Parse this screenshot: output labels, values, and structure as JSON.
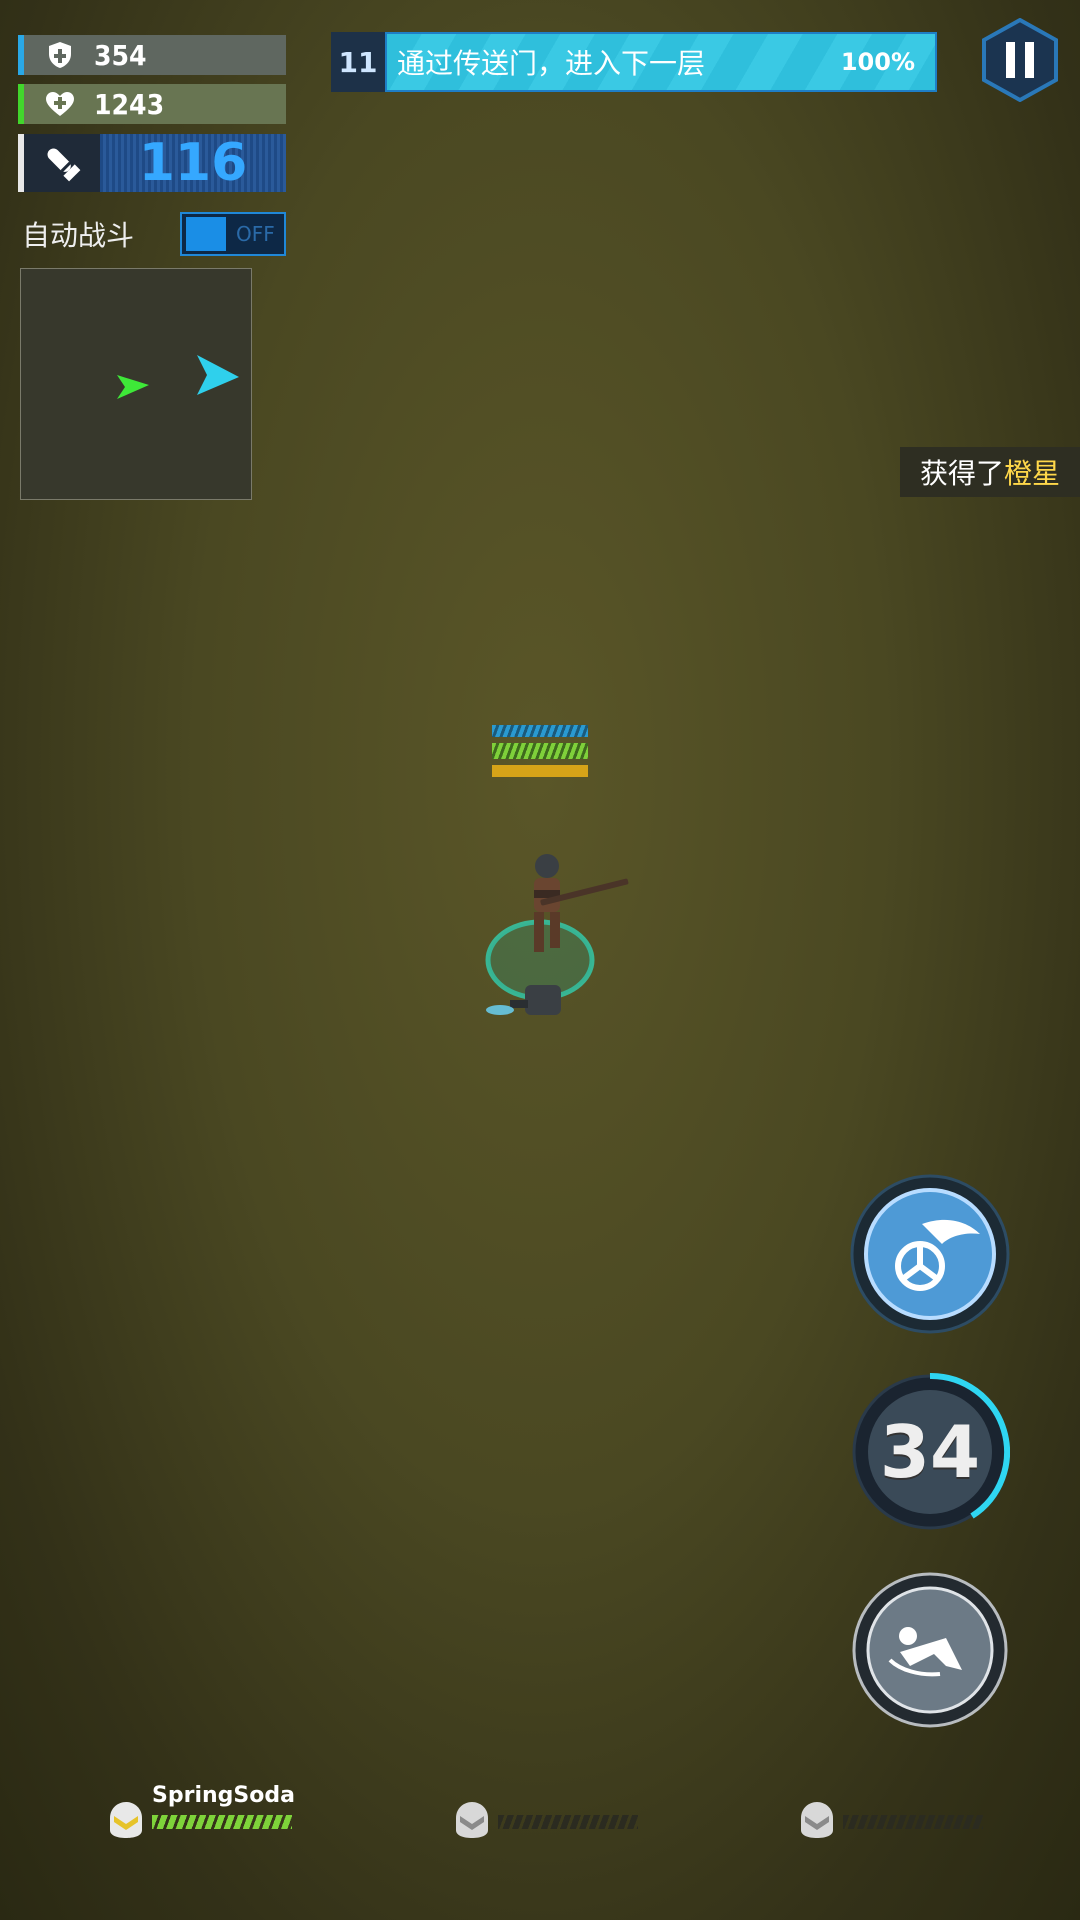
{
  "hud": {
    "shield": "354",
    "health": "1243",
    "ammo": "116",
    "auto_battle_label": "自动战斗",
    "auto_battle_state": "OFF"
  },
  "objective": {
    "floor": "11",
    "task": "通过传送门，进入下一层",
    "progress": "100%"
  },
  "loot_toast": {
    "prefix": "获得了",
    "item": "橙星",
    "item_color": "#ffd84a"
  },
  "skills": {
    "cooldown": "34"
  },
  "team": [
    {
      "name": "SpringSoda",
      "hp_level": 1.0
    },
    {
      "name": "",
      "hp_level": 0
    },
    {
      "name": "",
      "hp_level": 0
    }
  ],
  "colors": {
    "accent": "#2fbfdc",
    "health": "#42d62c",
    "shield": "#2aa8e6"
  }
}
